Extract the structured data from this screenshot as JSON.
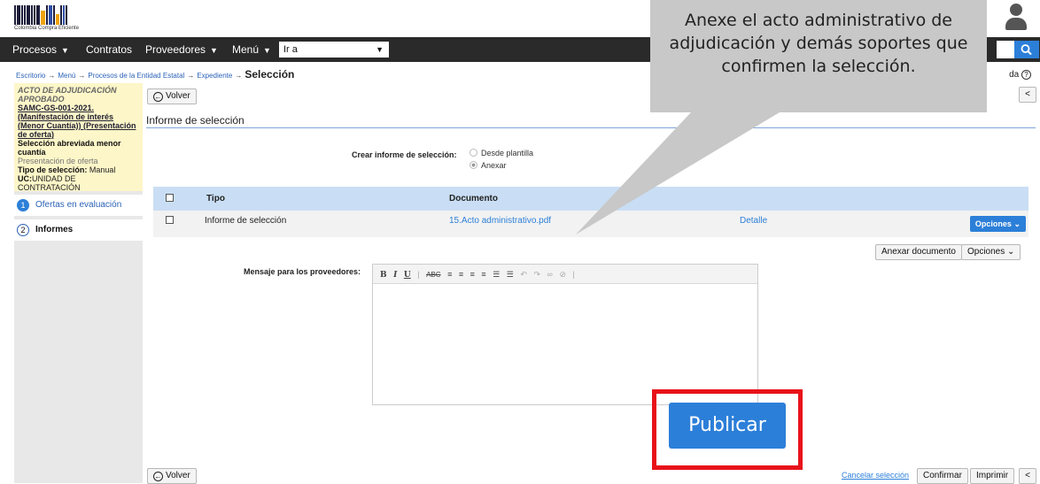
{
  "header": {
    "logo_text": "Colombia Compra Eficiente"
  },
  "nav": {
    "items": [
      "Procesos",
      "Contratos",
      "Proveedores",
      "Menú"
    ],
    "goto_value": "Ir a"
  },
  "breadcrumb": {
    "items": [
      "Escritorio",
      "Menú",
      "Procesos de la Entidad Estatal",
      "Expediente"
    ],
    "current": "Selección",
    "help_partial": "da"
  },
  "sidebar": {
    "status": "ACTO DE ADJUDICACIÓN APROBADO",
    "process_ref": "SAMC-GS-001-2021. (Manifestación de interés (Menor Cuantía)) (Presentación de oferta)",
    "process_type": "Selección abreviada menor cuantía",
    "phase": "Presentación de oferta",
    "selection_type_label": "Tipo de selección:",
    "selection_type_value": "Manual",
    "uc_label": "UC:",
    "uc_value": "UNIDAD DE CONTRATACIÓN",
    "steps": [
      {
        "num": "1",
        "label": "Ofertas en evaluación"
      },
      {
        "num": "2",
        "label": "Informes"
      }
    ]
  },
  "main": {
    "back_label": "Volver",
    "section_title": "Informe de selección",
    "crear_label": "Crear informe de selección:",
    "radio_options": [
      "Desde plantilla",
      "Anexar"
    ],
    "radio_selected": "Anexar",
    "table": {
      "headers": [
        "Tipo",
        "Documento"
      ],
      "rows": [
        {
          "tipo": "Informe de selección",
          "documento": "15.Acto administrativo.pdf",
          "detalle": "Detalle",
          "options": "Opciones"
        }
      ]
    },
    "anexar_button": "Anexar documento",
    "opciones_button": "Opciones",
    "message_label": "Mensaje para los proveedores:",
    "message_value": ""
  },
  "footer": {
    "back_label": "Volver",
    "cancel_link": "Cancelar selección",
    "confirm_button": "Confirmar",
    "print_button": "Imprimir",
    "collapse_button": "<"
  },
  "top_collapse_button": "<",
  "callout": {
    "text": "Anexe el acto administrativo de adjudicación y demás soportes que confirmen la selección."
  },
  "publish_button": "Publicar",
  "colors": {
    "accent": "#2c7fd8",
    "navbar": "#2a2a2a",
    "highlight_frame": "#e8121a",
    "table_header": "#c9def4",
    "sidebar_info": "#fdf6c8"
  }
}
